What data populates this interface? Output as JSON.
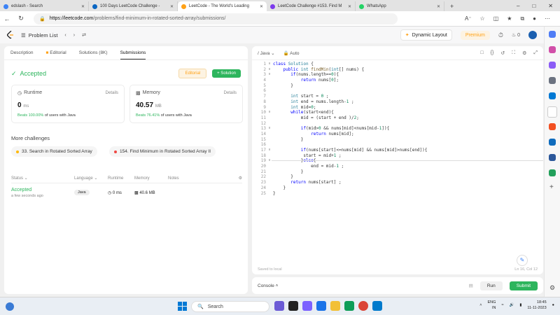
{
  "browser": {
    "tabs": [
      {
        "title": "edslash - Search",
        "color": "#3b82f6",
        "active": false
      },
      {
        "title": "100 Days LeetCode Challenge - ",
        "color": "#0a66c2",
        "active": false
      },
      {
        "title": "LeetCode - The World's Leading",
        "color": "#ffa116",
        "active": true
      },
      {
        "title": "LeetCode Challenge #153. Find M",
        "color": "#7c3aed",
        "active": false
      },
      {
        "title": "WhatsApp",
        "color": "#25d366",
        "active": false
      }
    ],
    "url_host": "https://leetcode.com",
    "url_path": "/problems/find-minimum-in-rotated-sorted-array/submissions/"
  },
  "header": {
    "problem_list": "Problem List",
    "dynamic_layout": "Dynamic Layout",
    "premium": "Premium",
    "notif_count": "0"
  },
  "left": {
    "tabs": [
      "Description",
      "Editorial",
      "Solutions (8K)",
      "Submissions"
    ],
    "status": "Accepted",
    "editorial_btn": "Editorial",
    "solution_btn": "+ Solution",
    "runtime": {
      "label": "Runtime",
      "details": "Details",
      "value": "0",
      "unit": "ms",
      "beats_pct": "Beats 100.00%",
      "beats_rest": "of users with Java"
    },
    "memory": {
      "label": "Memory",
      "details": "Details",
      "value": "40.57",
      "unit": "MB",
      "beats_pct": "Beats 76.41%",
      "beats_rest": "of users with Java"
    },
    "more_challenges": "More challenges",
    "challenges": [
      {
        "title": "33. Search in Rotated Sorted Array",
        "color": "#ffb800"
      },
      {
        "title": "154. Find Minimum in Rotated Sorted Array II",
        "color": "#ef4743"
      }
    ],
    "table_headers": [
      "Status",
      "Language",
      "Runtime",
      "Memory",
      "Notes"
    ],
    "row": {
      "status": "Accepted",
      "time": "a few seconds ago",
      "language": "Java",
      "runtime": "0 ms",
      "memory": "40.6 MB"
    }
  },
  "editor": {
    "language": "Java",
    "mode": "Auto",
    "saved": "Saved to local",
    "position": "Ln 16, Col 12",
    "lines": [
      "class Solution {",
      "    public int findMin(int[] nums) {",
      "       if(nums.length==0){",
      "           return nums[0];",
      "       }",
      "",
      "       int start = 0 ;",
      "       int end = nums.length-1 ;",
      "       int mid=0;",
      "       while(start<end){",
      "           mid = (start + end )/2;",
      "",
      "           if(mid>0 && nums[mid]<nums[mid-1]){",
      "               return nums[mid];",
      "           }",
      "",
      "           if(nums[start]<=nums[mid] && nums[mid]>nums[end]){",
      "            start = mid+1 ;",
      "           }else{",
      "               end = mid-1 ;",
      "           }",
      "       }",
      "       return nums[start] ;",
      "    }",
      "}"
    ]
  },
  "console": {
    "label": "Console",
    "run": "Run",
    "submit": "Submit"
  },
  "taskbar": {
    "search": "Search",
    "lang": "ENG",
    "region": "IN",
    "time": "18:45",
    "date": "11-11-2023"
  }
}
